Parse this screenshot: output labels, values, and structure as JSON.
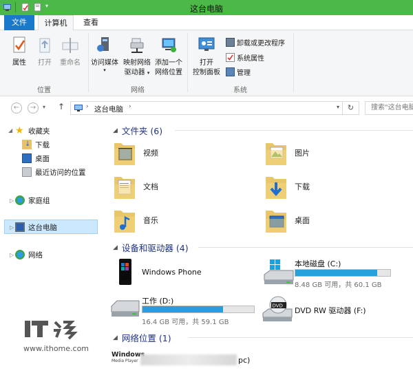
{
  "window": {
    "title": "这台电脑"
  },
  "tabs": {
    "file": "文件",
    "computer": "计算机",
    "view": "查看"
  },
  "ribbon": {
    "location": {
      "properties": "属性",
      "open": "打开",
      "rename": "重命名",
      "group": "位置"
    },
    "network": {
      "media": "访问媒体",
      "map_drive_1": "映射网络",
      "map_drive_2": "驱动器",
      "add_location_1": "添加一个",
      "add_location_2": "网络位置",
      "group": "网络"
    },
    "system": {
      "control_panel_1": "打开",
      "control_panel_2": "控制面板",
      "uninstall": "卸载或更改程序",
      "sys_props": "系统属性",
      "manage": "管理",
      "group": "系统"
    }
  },
  "address": {
    "path": "这台电脑",
    "search_placeholder": "搜索\"这台电脑\""
  },
  "nav": {
    "favorites": "收藏夹",
    "downloads": "下载",
    "desktop": "桌面",
    "recent": "最近访问的位置",
    "homegroup": "家庭组",
    "this_pc": "这台电脑",
    "network": "网络"
  },
  "folders": {
    "header": "文件夹 (6)",
    "items": [
      "视频",
      "图片",
      "文档",
      "下载",
      "音乐",
      "桌面"
    ]
  },
  "devices": {
    "header": "设备和驱动器 (4)",
    "phone": "Windows Phone",
    "c_name": "本地磁盘 (C:)",
    "c_info": "8.48 GB 可用，共 60.1 GB",
    "c_used_fraction": 0.86,
    "d_name": "工作 (D:)",
    "d_info": "16.4 GB 可用，共 59.1 GB",
    "d_used_fraction": 0.72,
    "f_name": "DVD RW 驱动器 (F:)"
  },
  "netloc": {
    "header": "网络位置 (1)",
    "item_suffix": "pc)",
    "wmp_logo_1": "Windows",
    "wmp_logo_2": "Media Player"
  },
  "watermark": {
    "brand": "IT",
    "url": "www.ithome.com"
  },
  "colors": {
    "titlebar": "#4cb848",
    "file_tab": "#1979ca",
    "selection": "#cce8ff",
    "drive_bar": "#26a0da",
    "section_text": "#1e3287"
  }
}
